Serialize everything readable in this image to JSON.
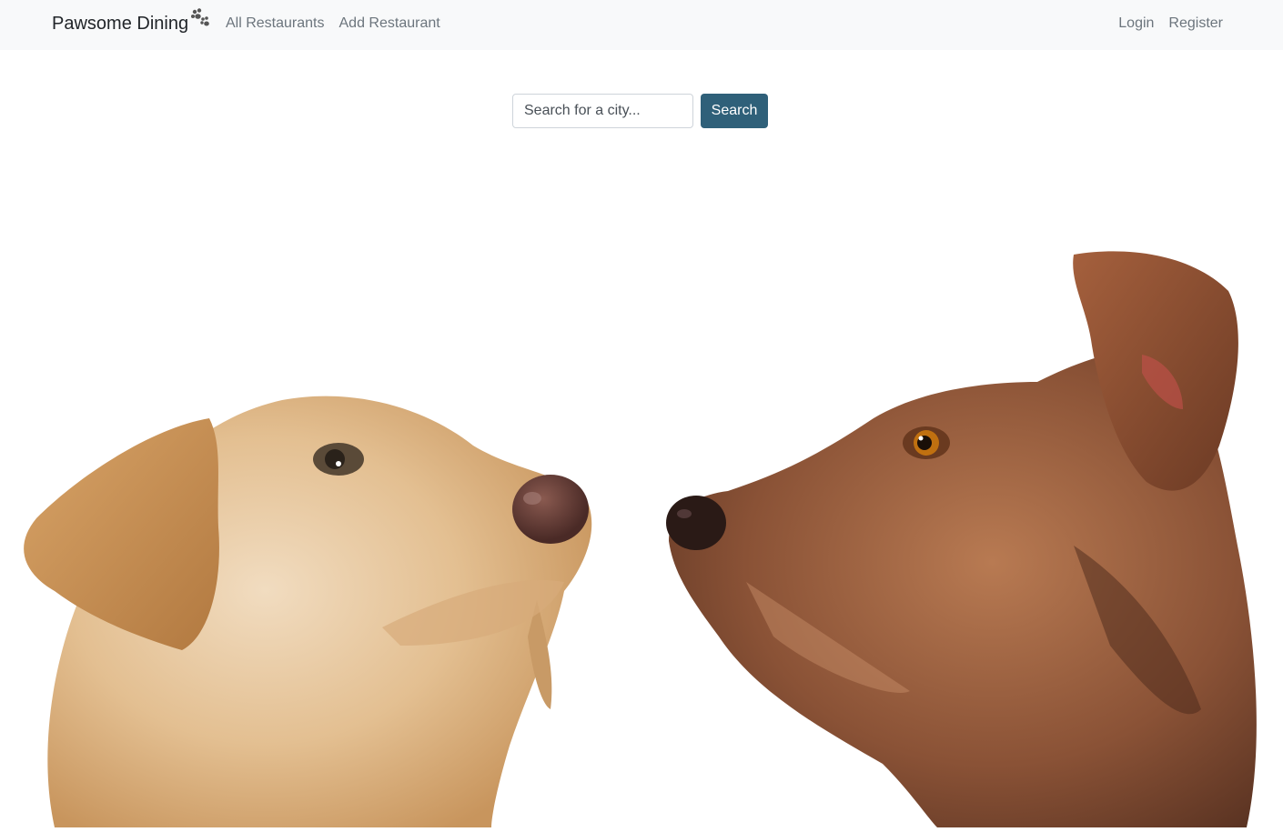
{
  "navbar": {
    "brand": "Pawsome Dining",
    "links": [
      "All Restaurants",
      "Add Restaurant"
    ],
    "auth": [
      "Login",
      "Register"
    ]
  },
  "search": {
    "placeholder": "Search for a city...",
    "button_label": "Search"
  },
  "hero": {
    "icon": "two-puppies-illustration"
  },
  "colors": {
    "navbar_bg": "#f8f9fa",
    "button_bg": "#2f6079"
  }
}
